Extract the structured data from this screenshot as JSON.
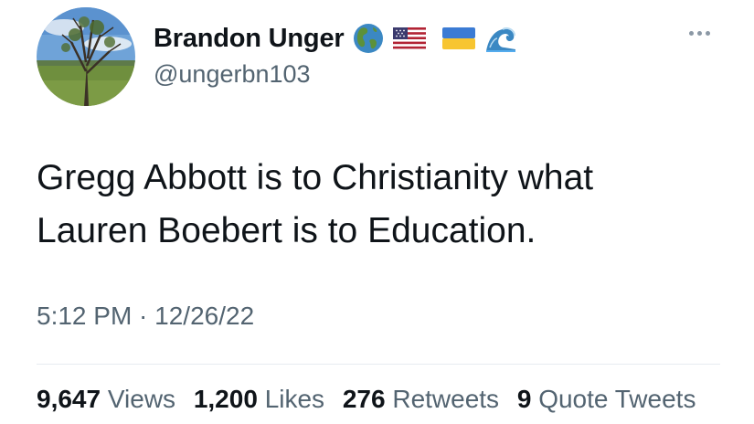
{
  "author": {
    "display_name": "Brandon Unger",
    "handle": "@ungerbn103",
    "badges": [
      "globe-americas-icon",
      "us-flag-icon",
      "ukraine-flag-icon",
      "wave-icon"
    ]
  },
  "tweet": {
    "text_lines": [
      "Gregg Abbott is to Christianity what",
      "Lauren Boebert is to Education."
    ],
    "timestamp": "5:12 PM · 12/26/22"
  },
  "stats": {
    "views": {
      "count": "9,647",
      "label": "Views"
    },
    "likes": {
      "count": "1,200",
      "label": "Likes"
    },
    "retweets": {
      "count": "276",
      "label": "Retweets"
    },
    "quotes": {
      "count": "9",
      "label": "Quote Tweets"
    }
  },
  "menu": {
    "icon": "more-options-icon"
  },
  "colors": {
    "text_primary": "#0f1419",
    "text_secondary": "#536471",
    "divider": "#e6ecf0"
  }
}
